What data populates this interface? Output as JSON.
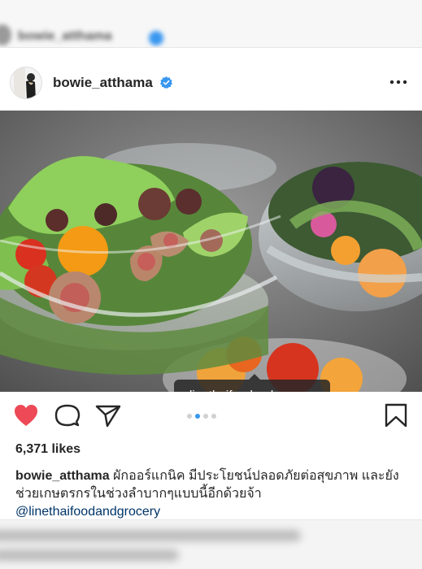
{
  "background_post": {
    "username": "bowie_atthama"
  },
  "post": {
    "username": "bowie_atthama",
    "verified": true,
    "more_icon": "ellipsis-icon",
    "photo_tag": "linethaifoodandgrocery",
    "carousel": {
      "total": 4,
      "active_index": 1
    },
    "likes": "6,371 likes",
    "caption": {
      "username": "bowie_atthama",
      "text": "ผักออร์แกนิค มีประโยชน์ปลอดภัยต่อสุขภาพ และยังช่วยเกษตรกรในช่วงลำบากๆแบบนี้อีกด้วยจ้า",
      "mention": "@linethaifoodandgrocery"
    },
    "actions": {
      "like_icon": "heart-icon",
      "comment_icon": "comment-icon",
      "share_icon": "share-icon",
      "save_icon": "bookmark-icon",
      "liked": true
    }
  },
  "colors": {
    "like_red": "#ed4956",
    "verified_blue": "#3897f0",
    "link_blue": "#003569",
    "text": "#262626"
  }
}
